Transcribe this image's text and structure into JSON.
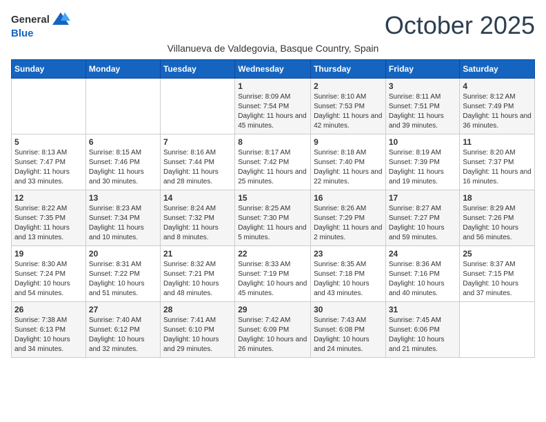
{
  "header": {
    "logo_general": "General",
    "logo_blue": "Blue",
    "month_title": "October 2025",
    "subtitle": "Villanueva de Valdegovia, Basque Country, Spain"
  },
  "days_of_week": [
    "Sunday",
    "Monday",
    "Tuesday",
    "Wednesday",
    "Thursday",
    "Friday",
    "Saturday"
  ],
  "weeks": [
    [
      {
        "day": "",
        "info": ""
      },
      {
        "day": "",
        "info": ""
      },
      {
        "day": "",
        "info": ""
      },
      {
        "day": "1",
        "info": "Sunrise: 8:09 AM\nSunset: 7:54 PM\nDaylight: 11 hours and 45 minutes."
      },
      {
        "day": "2",
        "info": "Sunrise: 8:10 AM\nSunset: 7:53 PM\nDaylight: 11 hours and 42 minutes."
      },
      {
        "day": "3",
        "info": "Sunrise: 8:11 AM\nSunset: 7:51 PM\nDaylight: 11 hours and 39 minutes."
      },
      {
        "day": "4",
        "info": "Sunrise: 8:12 AM\nSunset: 7:49 PM\nDaylight: 11 hours and 36 minutes."
      }
    ],
    [
      {
        "day": "5",
        "info": "Sunrise: 8:13 AM\nSunset: 7:47 PM\nDaylight: 11 hours and 33 minutes."
      },
      {
        "day": "6",
        "info": "Sunrise: 8:15 AM\nSunset: 7:46 PM\nDaylight: 11 hours and 30 minutes."
      },
      {
        "day": "7",
        "info": "Sunrise: 8:16 AM\nSunset: 7:44 PM\nDaylight: 11 hours and 28 minutes."
      },
      {
        "day": "8",
        "info": "Sunrise: 8:17 AM\nSunset: 7:42 PM\nDaylight: 11 hours and 25 minutes."
      },
      {
        "day": "9",
        "info": "Sunrise: 8:18 AM\nSunset: 7:40 PM\nDaylight: 11 hours and 22 minutes."
      },
      {
        "day": "10",
        "info": "Sunrise: 8:19 AM\nSunset: 7:39 PM\nDaylight: 11 hours and 19 minutes."
      },
      {
        "day": "11",
        "info": "Sunrise: 8:20 AM\nSunset: 7:37 PM\nDaylight: 11 hours and 16 minutes."
      }
    ],
    [
      {
        "day": "12",
        "info": "Sunrise: 8:22 AM\nSunset: 7:35 PM\nDaylight: 11 hours and 13 minutes."
      },
      {
        "day": "13",
        "info": "Sunrise: 8:23 AM\nSunset: 7:34 PM\nDaylight: 11 hours and 10 minutes."
      },
      {
        "day": "14",
        "info": "Sunrise: 8:24 AM\nSunset: 7:32 PM\nDaylight: 11 hours and 8 minutes."
      },
      {
        "day": "15",
        "info": "Sunrise: 8:25 AM\nSunset: 7:30 PM\nDaylight: 11 hours and 5 minutes."
      },
      {
        "day": "16",
        "info": "Sunrise: 8:26 AM\nSunset: 7:29 PM\nDaylight: 11 hours and 2 minutes."
      },
      {
        "day": "17",
        "info": "Sunrise: 8:27 AM\nSunset: 7:27 PM\nDaylight: 10 hours and 59 minutes."
      },
      {
        "day": "18",
        "info": "Sunrise: 8:29 AM\nSunset: 7:26 PM\nDaylight: 10 hours and 56 minutes."
      }
    ],
    [
      {
        "day": "19",
        "info": "Sunrise: 8:30 AM\nSunset: 7:24 PM\nDaylight: 10 hours and 54 minutes."
      },
      {
        "day": "20",
        "info": "Sunrise: 8:31 AM\nSunset: 7:22 PM\nDaylight: 10 hours and 51 minutes."
      },
      {
        "day": "21",
        "info": "Sunrise: 8:32 AM\nSunset: 7:21 PM\nDaylight: 10 hours and 48 minutes."
      },
      {
        "day": "22",
        "info": "Sunrise: 8:33 AM\nSunset: 7:19 PM\nDaylight: 10 hours and 45 minutes."
      },
      {
        "day": "23",
        "info": "Sunrise: 8:35 AM\nSunset: 7:18 PM\nDaylight: 10 hours and 43 minutes."
      },
      {
        "day": "24",
        "info": "Sunrise: 8:36 AM\nSunset: 7:16 PM\nDaylight: 10 hours and 40 minutes."
      },
      {
        "day": "25",
        "info": "Sunrise: 8:37 AM\nSunset: 7:15 PM\nDaylight: 10 hours and 37 minutes."
      }
    ],
    [
      {
        "day": "26",
        "info": "Sunrise: 7:38 AM\nSunset: 6:13 PM\nDaylight: 10 hours and 34 minutes."
      },
      {
        "day": "27",
        "info": "Sunrise: 7:40 AM\nSunset: 6:12 PM\nDaylight: 10 hours and 32 minutes."
      },
      {
        "day": "28",
        "info": "Sunrise: 7:41 AM\nSunset: 6:10 PM\nDaylight: 10 hours and 29 minutes."
      },
      {
        "day": "29",
        "info": "Sunrise: 7:42 AM\nSunset: 6:09 PM\nDaylight: 10 hours and 26 minutes."
      },
      {
        "day": "30",
        "info": "Sunrise: 7:43 AM\nSunset: 6:08 PM\nDaylight: 10 hours and 24 minutes."
      },
      {
        "day": "31",
        "info": "Sunrise: 7:45 AM\nSunset: 6:06 PM\nDaylight: 10 hours and 21 minutes."
      },
      {
        "day": "",
        "info": ""
      }
    ]
  ]
}
